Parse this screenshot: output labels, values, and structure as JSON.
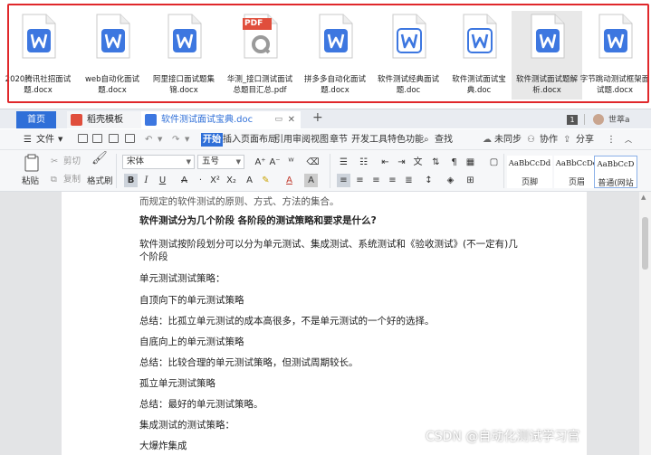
{
  "files": [
    {
      "label": "2020腾讯社招面试题.docx",
      "type": "word"
    },
    {
      "label": "web自动化面试题.docx",
      "type": "word"
    },
    {
      "label": "阿里接口面试题集锦.docx",
      "type": "word"
    },
    {
      "label": "华测_接口测试面试总题目汇总.pdf",
      "type": "pdf"
    },
    {
      "label": "拼多多自动化面试题.docx",
      "type": "word"
    },
    {
      "label": "软件测试经典面试题.doc",
      "type": "word"
    },
    {
      "label": "软件测试面试宝典.doc",
      "type": "word"
    },
    {
      "label": "软件测试面试题解析.docx",
      "type": "word",
      "selected": true
    },
    {
      "label": "字节跳动测试框架面试题.docx",
      "type": "word"
    }
  ],
  "pdf_badge": "PDF",
  "tabs": {
    "home": "首页",
    "template": "稻壳模板",
    "document": "软件测试面试宝典.doc",
    "add": "+"
  },
  "titlebar": {
    "count": "1",
    "user": "世萃a"
  },
  "menu": {
    "file": "文件",
    "items": [
      "开始",
      "插入",
      "页面布局",
      "引用",
      "审阅",
      "视图",
      "章节",
      "开发工具",
      "特色功能"
    ],
    "search": "查找",
    "sync": "未同步",
    "collab": "协作",
    "share": "分享"
  },
  "ribbon": {
    "paste": "粘贴",
    "cut": "剪切",
    "copy": "复制",
    "format_painter": "格式刷",
    "font_name": "宋体",
    "font_size": "五号",
    "styles": [
      {
        "sample": "AaBbCcDd",
        "name": "页脚"
      },
      {
        "sample": "AaBbCcDd",
        "name": "页眉"
      },
      {
        "sample": "AaBbCcD",
        "name": "普通(网站"
      }
    ]
  },
  "document": {
    "lines": [
      "而规定的软件测试的原则、方式、方法的集合。",
      "软件测试分为几个阶段 各阶段的测试策略和要求是什么?",
      "软件测试按阶段划分可以分为单元测试、集成测试、系统测试和《验收测试》(不一定有)几",
      "个阶段",
      "单元测试测试策略：",
      "自顶向下的单元测试策略",
      "总结：比孤立单元测试的成本高很多，不是单元测试的一个好的选择。",
      "自底向上的单元测试策略",
      "总结：比较合理的单元测试策略，但测试周期较长。",
      "孤立单元测试策略",
      "总结：最好的单元测试策略。",
      "集成测试的测试策略：",
      "大爆炸集成"
    ]
  },
  "watermark": "CSDN @自动化测试学习官",
  "colors": {
    "accent": "#2f6fd8",
    "highlight_border": "#e0282b",
    "word_icon": "#3d77e0",
    "pdf_icon": "#e04e3c"
  }
}
